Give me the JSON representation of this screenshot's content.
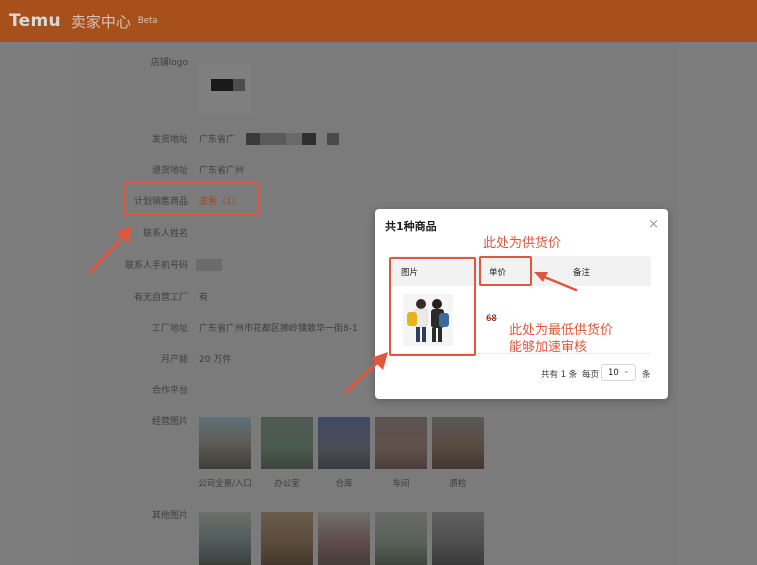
{
  "topbar": {
    "brand": "Temu",
    "subtitle": "卖家中心",
    "badge": "Beta"
  },
  "form": {
    "logo_label": "店铺logo",
    "ship_addr_label": "发货地址",
    "ship_addr_value": "广东省广",
    "return_addr_label": "退货地址",
    "return_addr_value": "广东省广州",
    "plan_goods_label": "计划销售商品",
    "plan_goods_link": "查看（1）",
    "contact_name_label": "联系人姓名",
    "contact_phone_label": "联系人手机号码",
    "own_factory_label": "有无自营工厂",
    "own_factory_value": "有",
    "factory_addr_label": "工厂地址",
    "factory_addr_value": "广东省广州市花都区狮岭镇致华一街8-1",
    "capacity_label": "月产能",
    "capacity_value": "20 万件",
    "platform_label": "合作平台",
    "biz_images_label": "经营图片",
    "other_images_label": "其他图片"
  },
  "biz_images": [
    {
      "caption": "公司全景/入口"
    },
    {
      "caption": "办公室"
    },
    {
      "caption": "仓库"
    },
    {
      "caption": "车间"
    },
    {
      "caption": "质检"
    }
  ],
  "modal": {
    "title": "共1种商品",
    "col_image": "图片",
    "col_price": "单价",
    "col_note": "备注",
    "price": "68",
    "pager_total": "共有 1 条",
    "pager_per": "每页",
    "pager_size": "10",
    "pager_unit": "条"
  },
  "annotations": {
    "supply_price": "此处为供货价",
    "lowest_line1": "此处为最低供货价",
    "lowest_line2": "能够加速审核"
  },
  "colors": {
    "brand_bar": "#a8501c",
    "annotation": "#e0573e"
  }
}
